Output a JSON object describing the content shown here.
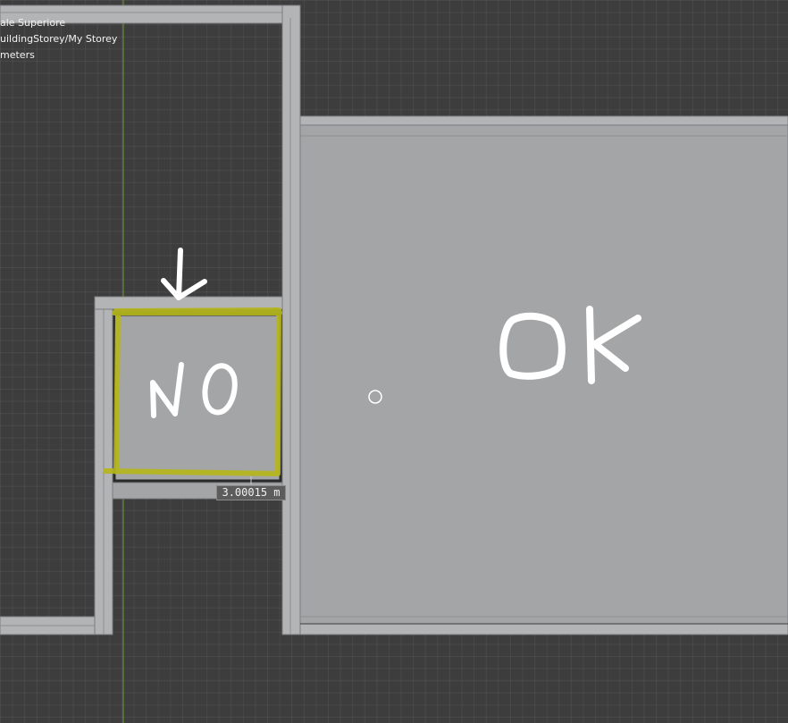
{
  "viewport": {
    "info": {
      "line1": "ale Superiore",
      "line2": "uildingStorey/My Storey",
      "line3": "meters"
    },
    "dimension_label": "3.00015 m",
    "annotations": {
      "no_label": "NO",
      "ok_label": "OK"
    },
    "colors": {
      "background": "#3d3d3d",
      "slab": "#a4a5a7",
      "wall": "#b3b4b6",
      "highlight": "#b5b51c",
      "axis": "#6f9a3c"
    },
    "icons": {
      "arrow": "arrow-down-icon",
      "cursor": "cursor-circle-icon"
    }
  }
}
